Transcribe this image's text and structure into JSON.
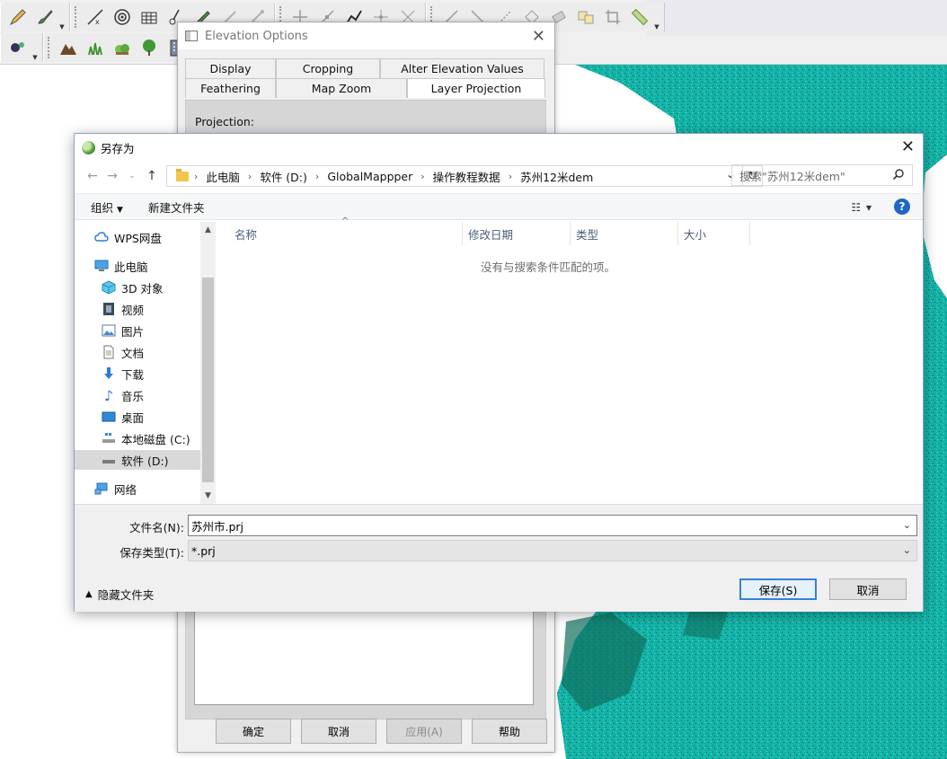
{
  "elevation_dialog": {
    "title": "Elevation Options",
    "tabs_row1": [
      "Display",
      "Cropping",
      "Alter Elevation Values"
    ],
    "tabs_row2": [
      "Feathering",
      "Map Zoom",
      "Layer Projection"
    ],
    "projection_label": "Projection:",
    "buttons": {
      "ok": "确定",
      "cancel": "取消",
      "apply": "应用(A)",
      "help": "帮助"
    }
  },
  "save_dialog": {
    "title": "另存为",
    "breadcrumb": [
      "此电脑",
      "软件 (D:)",
      "GlobalMappper",
      "操作教程数据",
      "苏州12米dem"
    ],
    "search_placeholder": "搜索\"苏州12米dem\"",
    "organize_label": "组织",
    "new_folder_label": "新建文件夹",
    "nav": {
      "wps": "WPS网盘",
      "this_pc": "此电脑",
      "objects3d": "3D 对象",
      "videos": "视频",
      "pictures": "图片",
      "documents": "文档",
      "downloads": "下载",
      "music": "音乐",
      "desktop": "桌面",
      "local_disk": "本地磁盘 (C:)",
      "soft_disk": "软件 (D:)",
      "network": "网络"
    },
    "columns": {
      "name": "名称",
      "modified": "修改日期",
      "type": "类型",
      "size": "大小"
    },
    "empty_message": "没有与搜索条件匹配的项。",
    "filename_label": "文件名(N):",
    "filename_value": "苏州市.prj",
    "filetype_label": "保存类型(T):",
    "filetype_value": "*.prj",
    "hide_folders_label": "隐藏文件夹",
    "save_button": "保存(S)",
    "cancel_button": "取消"
  },
  "colors": {
    "map_teal": "#14b3a7",
    "map_dark": "#0e6f5e",
    "accent_blue": "#3c7fd6",
    "help_blue": "#1e66c8"
  }
}
